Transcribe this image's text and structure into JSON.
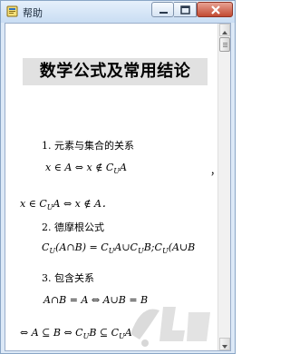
{
  "window": {
    "title": "帮助",
    "controls": {
      "minimize": "minimize",
      "maximize": "maximize",
      "close": "close"
    }
  },
  "document": {
    "title": "数学公式及常用结论",
    "s1": {
      "heading": "1. 元素与集合的关系",
      "f1": "x ∈ A ⇔ x ∉ C",
      "f1_sub": "U",
      "f1_end": "A",
      "comma": "，",
      "f2": "x ∈ C",
      "f2_sub": "U",
      "f2_end": "A ⇔ x ∉ A．"
    },
    "s2": {
      "heading": "2. 德摩根公式",
      "formula": "C",
      "formula_sub": "U",
      "formula_rest": "(A∩B) = C",
      "formula_sub2": "U",
      "formula_rest2": "A∪C",
      "formula_sub3": "U",
      "formula_rest3": "B;C",
      "formula_sub4": "U",
      "formula_rest4": "(A∪B"
    },
    "s3": {
      "heading": "3. 包含关系",
      "f1": "A∩B = A ⇔ A∪B = B",
      "f2": "⇔ A ⊆ B ⇔ C",
      "f2_sub": "U",
      "f2_rest": "B ⊆ C",
      "f2_sub2": "U",
      "f2_end": "A"
    }
  },
  "colors": {
    "title_highlight": "#e1e1e1",
    "titlebar": "#c9ddf3",
    "close": "#c24a32"
  },
  "icons": [
    "help-book-icon",
    "minimize-icon",
    "maximize-icon",
    "close-icon",
    "scroll-up-arrow-icon",
    "scroll-down-arrow-icon",
    "watermark-logo-icon"
  ]
}
